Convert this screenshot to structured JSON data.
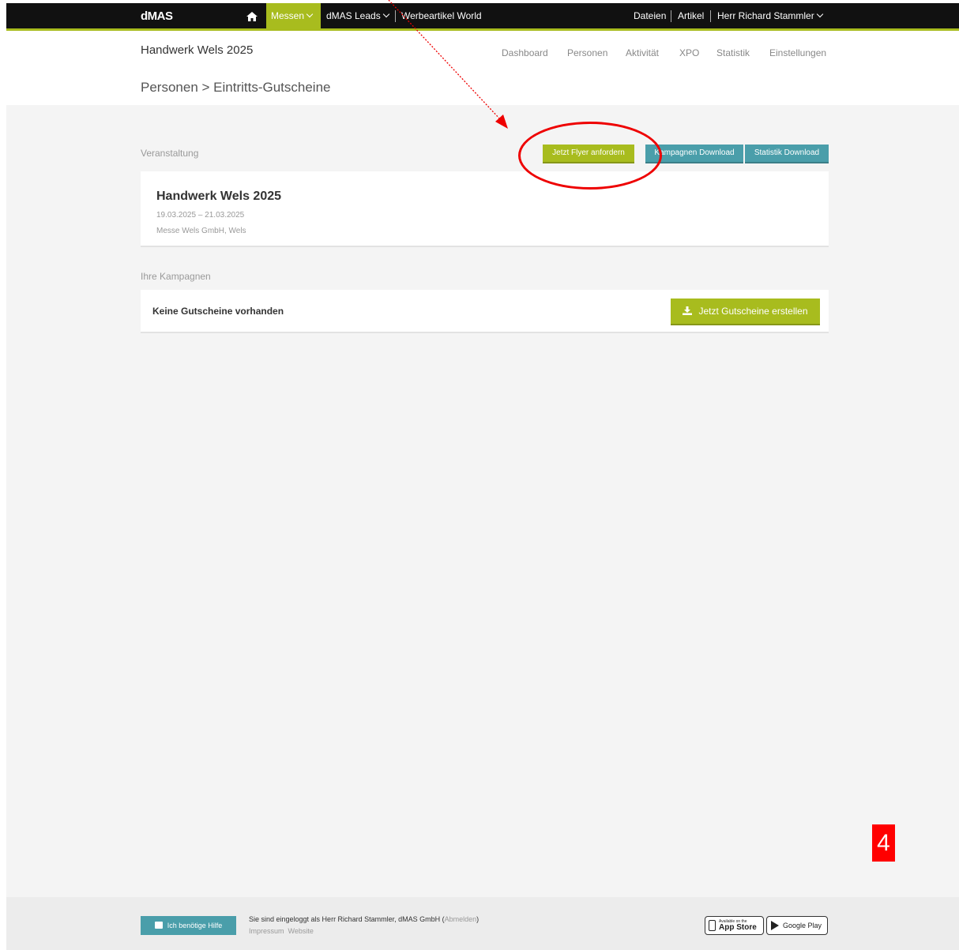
{
  "topnav": {
    "logo": "dMAS",
    "messen_label": "Messen",
    "leads_label": "dMAS Leads",
    "werbeartikel_label": "Werbeartikel World",
    "dateien_label": "Dateien",
    "artikel_label": "Artikel",
    "user_label": "Herr Richard Stammler",
    "accent_color": "#a8bc1e"
  },
  "header": {
    "event_title": "Handwerk Wels 2025",
    "subnav": [
      "Dashboard",
      "Personen",
      "Aktivität",
      "XPO",
      "Statistik",
      "Einstellungen"
    ],
    "breadcrumb": "Personen > Eintritts-Gutscheine"
  },
  "veranstaltung": {
    "section_label": "Veranstaltung",
    "flyer_button": "Jetzt Flyer anfordern",
    "kampagnen_button": "Kampagnen Download",
    "statistik_button": "Statistik Download",
    "event_name": "Handwerk Wels 2025",
    "event_dates": "19.03.2025 – 21.03.2025",
    "event_location": "Messe Wels GmbH, Wels"
  },
  "kampagnen": {
    "section_label": "Ihre Kampagnen",
    "empty_text": "Keine Gutscheine vorhanden",
    "create_button": "Jetzt Gutscheine erstellen"
  },
  "annotation": {
    "step_number": "4",
    "color": "#ff0000"
  },
  "footer": {
    "help_button": "Ich benötige Hilfe",
    "login_text": "Sie sind eingeloggt als Herr Richard Stammler, dMAS GmbH (",
    "logout_link": "Abmelden",
    "login_text_end": ")",
    "impressum_link": "Impressum",
    "website_link": "Website",
    "appstore_small": "Available on the",
    "appstore_label": "App Store",
    "googleplay_label": "Google Play"
  }
}
